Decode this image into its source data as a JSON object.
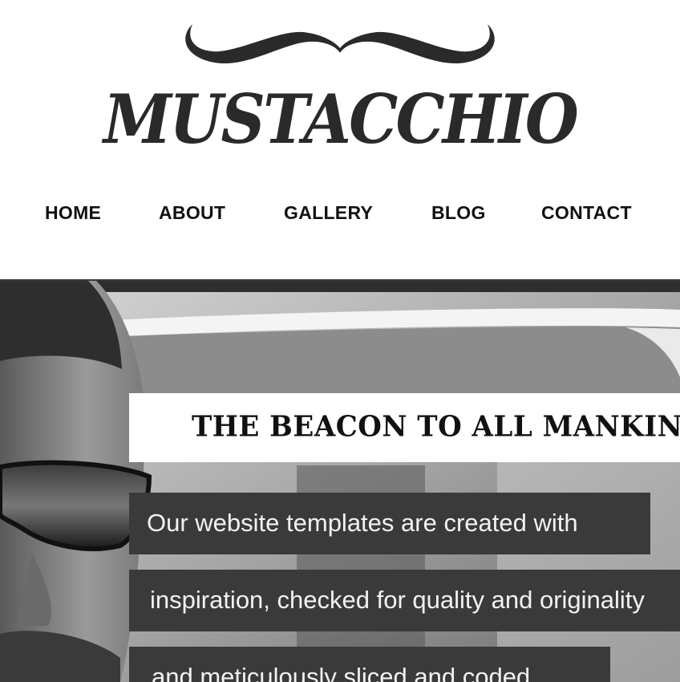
{
  "logo": {
    "text": "MUSTACCHIO"
  },
  "nav": {
    "items": [
      {
        "label": "HOME"
      },
      {
        "label": "ABOUT"
      },
      {
        "label": "GALLERY"
      },
      {
        "label": "BLOG"
      },
      {
        "label": "CONTACT"
      }
    ]
  },
  "hero": {
    "headline": "THE BEACON TO ALL MANKIND",
    "lines": [
      "Our website templates are created with",
      "inspiration, checked for quality and originality",
      "and meticulously sliced and coded."
    ]
  }
}
